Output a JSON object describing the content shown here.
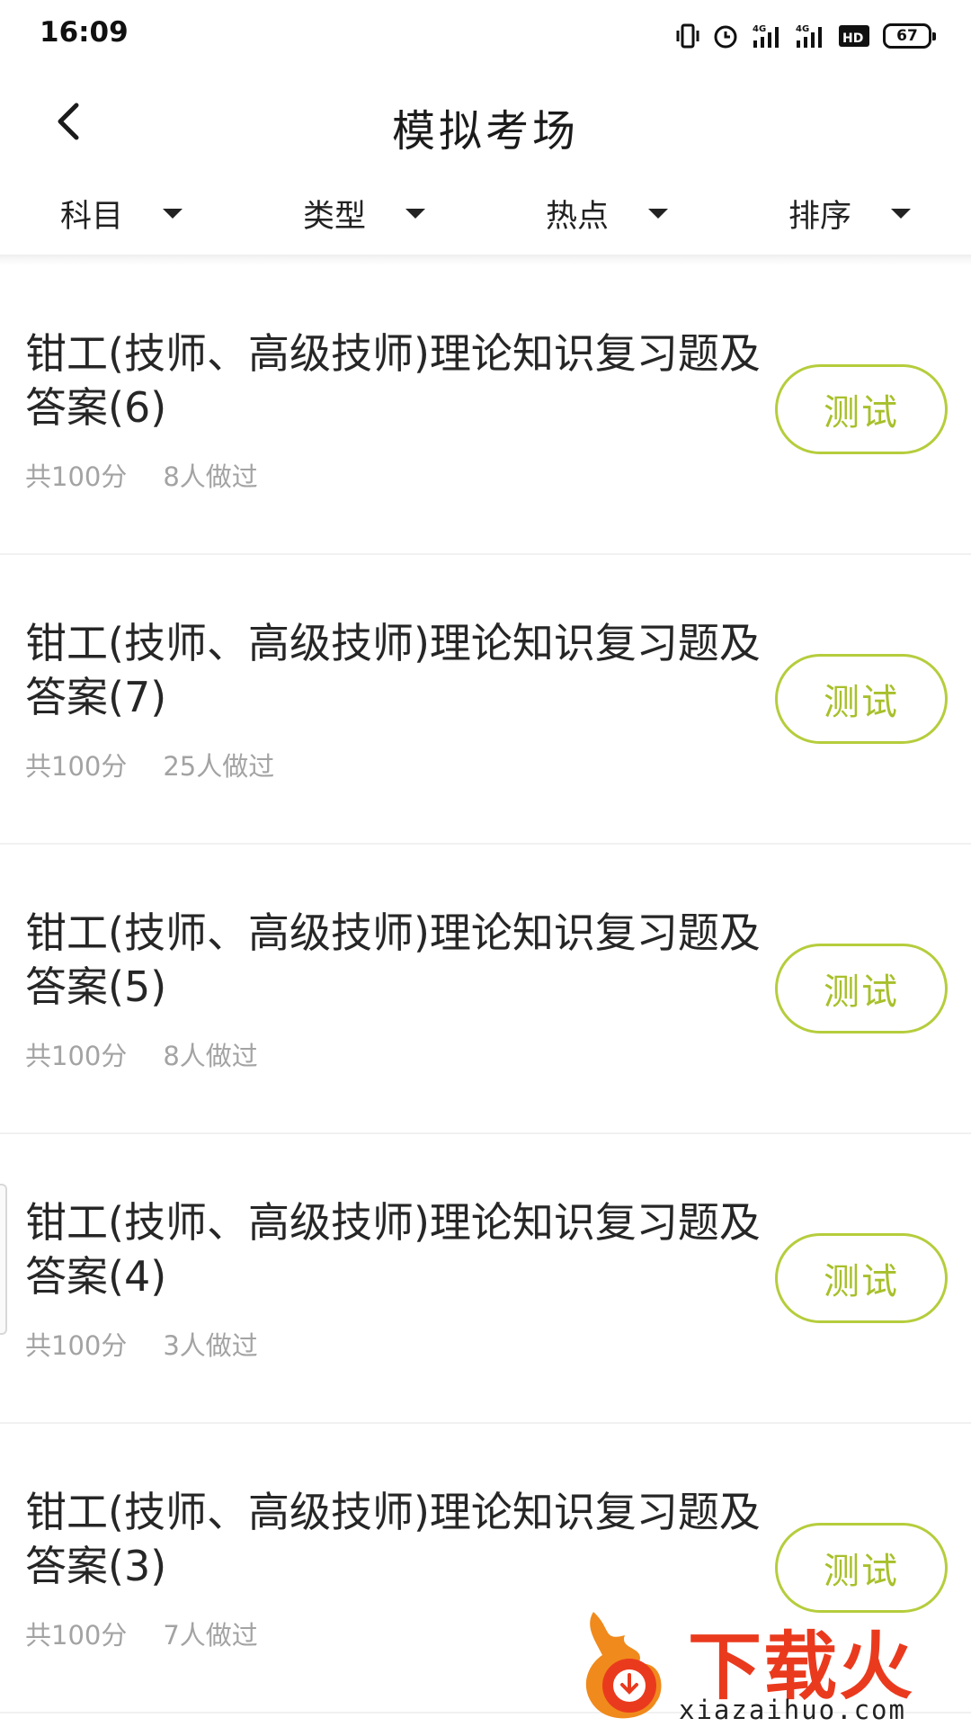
{
  "status_bar": {
    "time": "16:09",
    "battery": "67",
    "icons": [
      "vibrate-icon",
      "alarm-icon",
      "signal-4g-icon",
      "signal-4g-icon",
      "hd-icon",
      "battery-icon"
    ]
  },
  "header": {
    "title": "模拟考场",
    "back_icon": "chevron-left-icon"
  },
  "filters": [
    {
      "label": "科目"
    },
    {
      "label": "类型"
    },
    {
      "label": "热点"
    },
    {
      "label": "排序"
    }
  ],
  "exams": [
    {
      "title": "钳工(技师、高级技师)理论知识复习题及答案(6)",
      "score": "共100分",
      "takers": "8人做过",
      "button": "测试"
    },
    {
      "title": "钳工(技师、高级技师)理论知识复习题及答案(7)",
      "score": "共100分",
      "takers": "25人做过",
      "button": "测试"
    },
    {
      "title": "钳工(技师、高级技师)理论知识复习题及答案(5)",
      "score": "共100分",
      "takers": "8人做过",
      "button": "测试"
    },
    {
      "title": "钳工(技师、高级技师)理论知识复习题及答案(4)",
      "score": "共100分",
      "takers": "3人做过",
      "button": "测试"
    },
    {
      "title": "钳工(技师、高级技师)理论知识复习题及答案(3)",
      "score": "共100分",
      "takers": "7人做过",
      "button": "测试"
    }
  ],
  "watermark": {
    "text": "下载火",
    "url": "xiazaihuo.com"
  },
  "colors": {
    "accent": "#a7c02b",
    "accent_border": "#b5cd3c",
    "meta_text": "#a3a3a3",
    "watermark": "#ea3a1e"
  }
}
